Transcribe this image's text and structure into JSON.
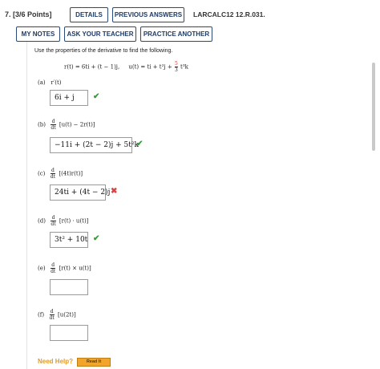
{
  "header": {
    "question_number": "7. [3/6 Points]",
    "details_label": "DETAILS",
    "previous_answers_label": "PREVIOUS ANSWERS",
    "reference": "LARCALC12 12.R.031.",
    "my_notes_label": "MY NOTES",
    "ask_teacher_label": "ASK YOUR TEACHER",
    "practice_another_label": "PRACTICE ANOTHER"
  },
  "problem": {
    "instructions": "Use the properties of the derivative to find the following.",
    "r_def": "r(t) = 6ti + (t − 1)j,",
    "u_def_prefix": "u(t) = ti + t²j +",
    "u_frac_num": "5",
    "u_frac_den": "3",
    "u_def_suffix": "t³k"
  },
  "parts": [
    {
      "label": "(a)",
      "expr": "r′(t)",
      "answer": "6i + j",
      "status": "correct"
    },
    {
      "label": "(b)",
      "d_num": "d",
      "d_den": "dt",
      "expr": "[u(t) − 2r(t)]",
      "answer": "−11i + (2t − 2)j + 5t²k",
      "status": "correct"
    },
    {
      "label": "(c)",
      "d_num": "d",
      "d_den": "dt",
      "expr": "[(4t)r(t)]",
      "answer": "24ti + (4t − 2)j",
      "status": "incorrect"
    },
    {
      "label": "(d)",
      "d_num": "d",
      "d_den": "dt",
      "expr": "[r(t) · u(t)]",
      "answer": "3t² + 10t",
      "status": "correct"
    },
    {
      "label": "(e)",
      "d_num": "d",
      "d_den": "dt",
      "expr": "[r(t) × u(t)]",
      "answer": "",
      "status": "empty"
    },
    {
      "label": "(f)",
      "d_num": "d",
      "d_den": "dt",
      "expr": "[u(2t)]",
      "answer": "",
      "status": "empty"
    }
  ],
  "footer": {
    "need_help": "Need Help?",
    "read_it": "Read It"
  },
  "colors": {
    "button_border": "#2a4a7c",
    "correct": "#3a9a3a",
    "incorrect": "#d64545",
    "help": "#e49b26"
  },
  "icons": {
    "correct": "check-icon",
    "incorrect": "cross-icon"
  }
}
